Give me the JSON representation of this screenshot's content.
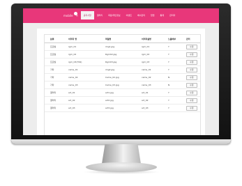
{
  "nav": {
    "logo": "mobile",
    "menu": [
      "홈",
      "공지사항",
      "갤러리",
      "회원/개인정보",
      "이벤트",
      "배너관리",
      "팝업",
      "통계",
      "관리자"
    ],
    "active_index": 1
  },
  "table": {
    "headers": [
      "분류",
      "이미지 명",
      "파일명",
      "이미지설명",
      "노출여부",
      "관리"
    ],
    "rows": [
      [
        "프로필",
        "rgm_01",
        "img1.jpg",
        "rgm_01",
        "Y",
        "수정"
      ],
      [
        "프로필",
        "rgm_02",
        "Rgm02.jpg",
        "rgm_02",
        "Y",
        "수정"
      ],
      [
        "프로필",
        "rgm_03(799)",
        "Rgm03.jpg",
        "rgm_03",
        "Y",
        "수정"
      ],
      [
        "기타",
        "came_01",
        "img2.jpg",
        "came_01",
        "Y",
        "수정"
      ],
      [
        "기타",
        "came_02",
        "Came_02.jpg",
        "came_02",
        "N",
        "수정"
      ],
      [
        "기타",
        "came_03",
        "Came_03.jpg",
        "came_03",
        "N",
        "수정"
      ],
      [
        "갤러리",
        "art_01",
        "art1.jpg",
        "art_01",
        "Y",
        "수정"
      ],
      [
        "갤러리",
        "art_02",
        "art2.jpg",
        "art_02",
        "Y",
        "수정"
      ],
      [
        "갤러리",
        "art_03",
        "art3.jpg",
        "art_03",
        "Y",
        "수정"
      ]
    ]
  },
  "colors": {
    "nav_bg": "#e8377a",
    "active_tab_bg": "#f3f3f3"
  }
}
